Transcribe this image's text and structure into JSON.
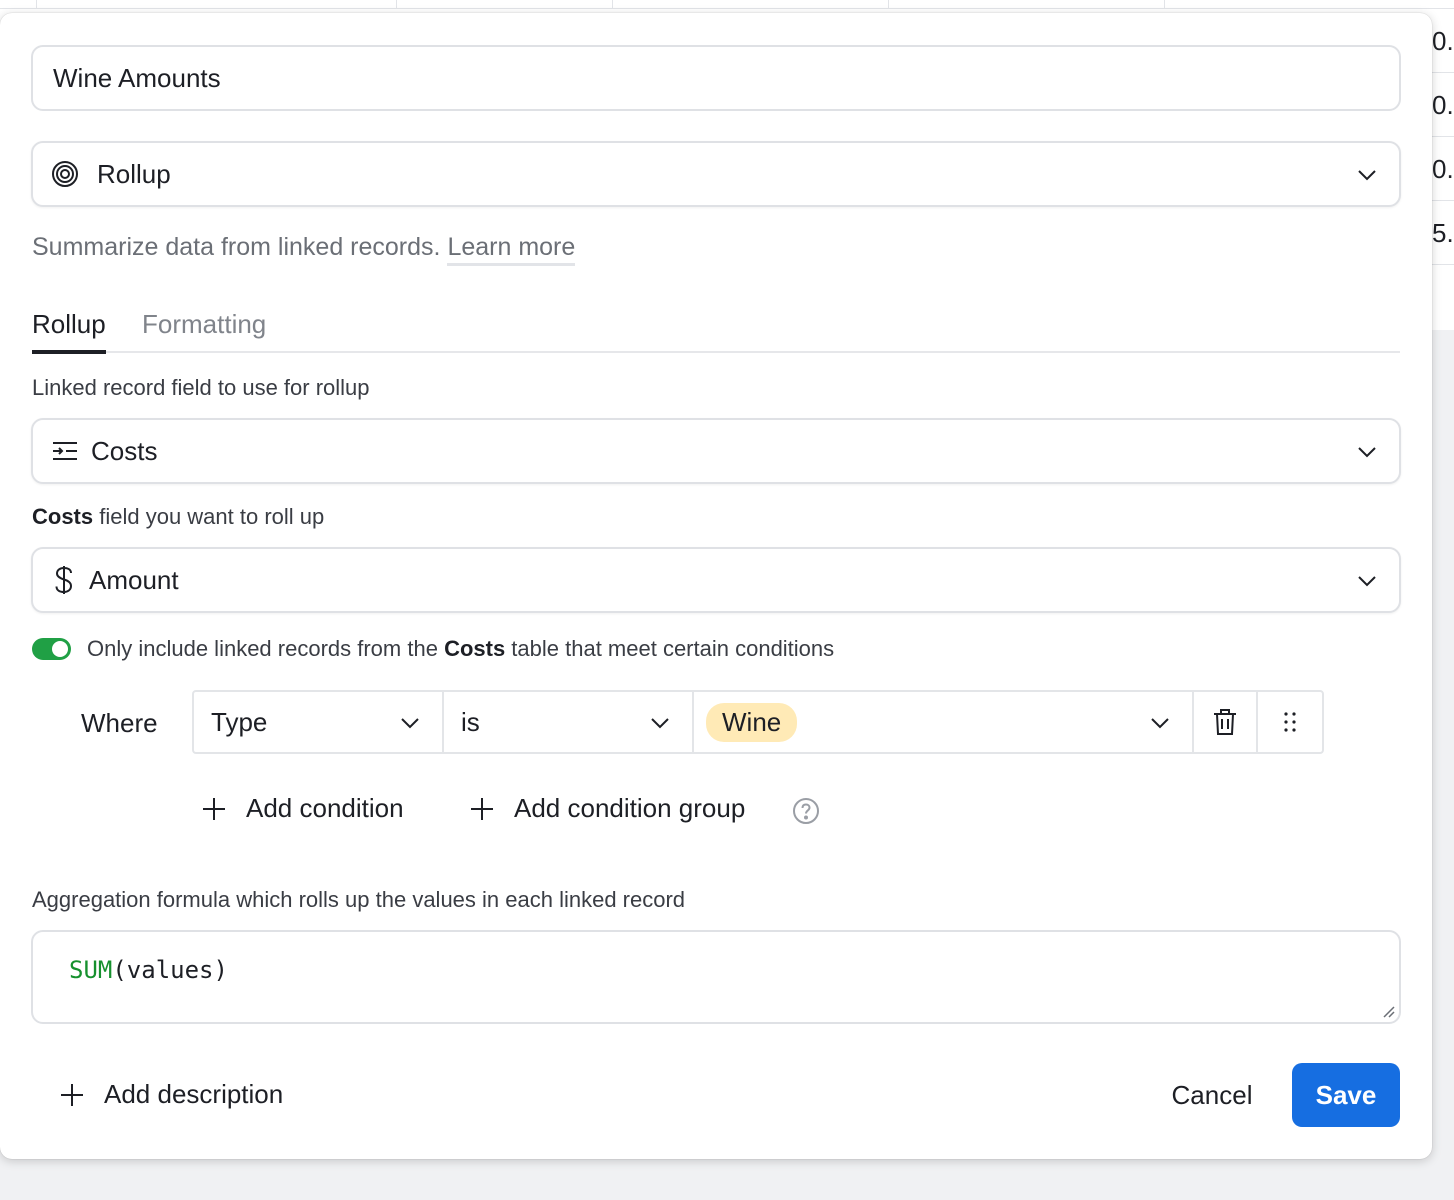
{
  "background_table": {
    "visible_cells": [
      "0.",
      "0.",
      "0.",
      "5."
    ]
  },
  "dialog": {
    "field_name": "Wine Amounts",
    "field_type": {
      "label": "Rollup",
      "icon": "rollup-icon"
    },
    "description": "Summarize data from linked records.",
    "learn_more": "Learn more",
    "tabs": [
      {
        "label": "Rollup",
        "active": true
      },
      {
        "label": "Formatting",
        "active": false
      }
    ],
    "linked_field": {
      "label": "Linked record field to use for rollup",
      "value": "Costs",
      "icon": "linked-records-icon"
    },
    "rollup_field": {
      "label_bold": "Costs",
      "label_rest": " field you want to roll up",
      "value": "Amount",
      "icon": "dollar-icon"
    },
    "condition_toggle": {
      "on": true,
      "text_before": "Only include linked records from the ",
      "text_bold": "Costs",
      "text_after": " table that meet certain conditions"
    },
    "condition": {
      "where_label": "Where",
      "field": "Type",
      "operator": "is",
      "value": "Wine"
    },
    "add_condition": "Add condition",
    "add_condition_group": "Add condition group",
    "aggregation": {
      "label": "Aggregation formula which rolls up the values in each linked record",
      "formula_fn": "SUM",
      "formula_args": "(values)"
    },
    "add_description": "Add description",
    "cancel_label": "Cancel",
    "save_label": "Save"
  },
  "colors": {
    "primary": "#166ee1",
    "toggle_on": "#20a045",
    "pill": "#ffeab6",
    "formula_fn": "#16902e"
  }
}
